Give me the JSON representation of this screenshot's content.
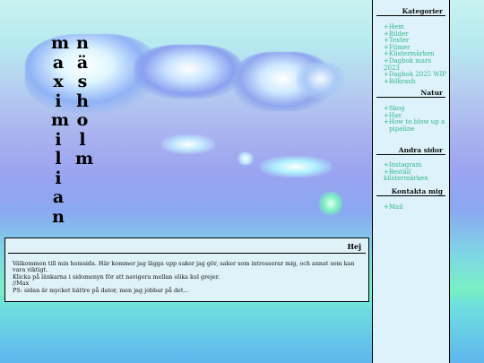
{
  "name_columns": {
    "first": [
      "m",
      "a",
      "x",
      "i",
      "m",
      "i",
      "l",
      "i",
      "a",
      "n"
    ],
    "last": [
      "n",
      "ä",
      "s",
      "h",
      "o",
      "l",
      "m"
    ]
  },
  "sidebar": {
    "categories": {
      "title": "Kategorier",
      "items": [
        "+Hem",
        "+Bilder",
        "+Texter",
        "+Filmer",
        "+Klistermärken",
        "+Dagbok mars 2023",
        "+Dagbok 2025 WIP",
        "+Bilkrash"
      ]
    },
    "nature": {
      "title": "Natur",
      "items": [
        "+Skog",
        "+Hav",
        "+How to blow up a",
        "pipeline"
      ]
    },
    "other": {
      "title": "Andra sidor",
      "items": [
        "+Instagram",
        "+Beställ klistermärken"
      ]
    },
    "contact": {
      "title": "Kontakta mig",
      "items": [
        "+Mail"
      ]
    }
  },
  "welcome": {
    "title": "Hej",
    "lines": [
      "Välkommen till min hemsida. Här kommer jag lägga upp saker jag gör, saker som intresserar mig, och annat som kan vara viktigt.",
      "Klicka på länkarna i sidomenyn för att navigera mellan olika kul grejer.",
      "//Max",
      "PS: sidan är mycket bättre på dator, men jag jobbar på det..."
    ]
  },
  "colors": {
    "link": "#31b88a",
    "panel_bg": "#ddf2fb"
  }
}
